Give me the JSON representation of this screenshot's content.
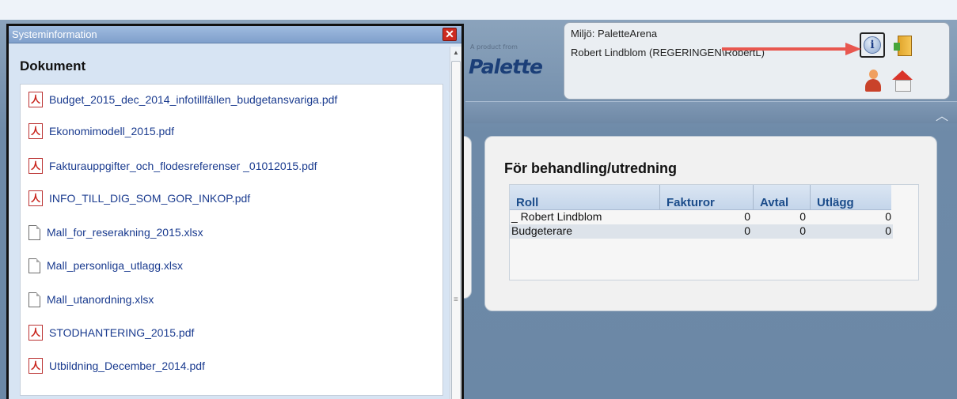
{
  "header": {
    "logo_small": "A product from",
    "logo_text": "Palette",
    "environment": "Miljö: PaletteArena",
    "user": "Robert Lindblom (REGERINGEN\\RobertL)"
  },
  "icons": {
    "info": "info-icon",
    "exit": "exit-door-icon",
    "person": "person-icon",
    "home": "home-icon",
    "collapse": "chevron-up-icon"
  },
  "colors": {
    "annotation_arrow": "#e8574f",
    "link": "#1a3b8f",
    "grid_header_text": "#1b4c8a"
  },
  "panel": {
    "title": "För behandling/utredning",
    "columns": [
      "Roll",
      "Fakturor",
      "Avtal",
      "Utlägg"
    ],
    "rows": [
      [
        "_ Robert Lindblom",
        "0",
        "0",
        "0"
      ],
      [
        "Budgeterare",
        "0",
        "0",
        "0"
      ]
    ]
  },
  "modal": {
    "title": "Systeminformation",
    "close_label": "✕",
    "heading": "Dokument",
    "documents": [
      {
        "name": "Budget_2015_dec_2014_infotillfällen_budgetansvariga.pdf",
        "type": "pdf"
      },
      {
        "name": "Ekonomimodell_2015.pdf",
        "type": "pdf"
      },
      {
        "name": "Fakturauppgifter_och_flodesreferenser _01012015.pdf",
        "type": "pdf"
      },
      {
        "name": "INFO_TILL_DIG_SOM_GOR_INKOP.pdf",
        "type": "pdf"
      },
      {
        "name": "Mall_for_reserakning_2015.xlsx",
        "type": "file"
      },
      {
        "name": "Mall_personliga_utlagg.xlsx",
        "type": "file"
      },
      {
        "name": "Mall_utanordning.xlsx",
        "type": "file"
      },
      {
        "name": "STODHANTERING_2015.pdf",
        "type": "pdf"
      },
      {
        "name": "Utbildning_December_2014.pdf",
        "type": "pdf"
      }
    ]
  }
}
